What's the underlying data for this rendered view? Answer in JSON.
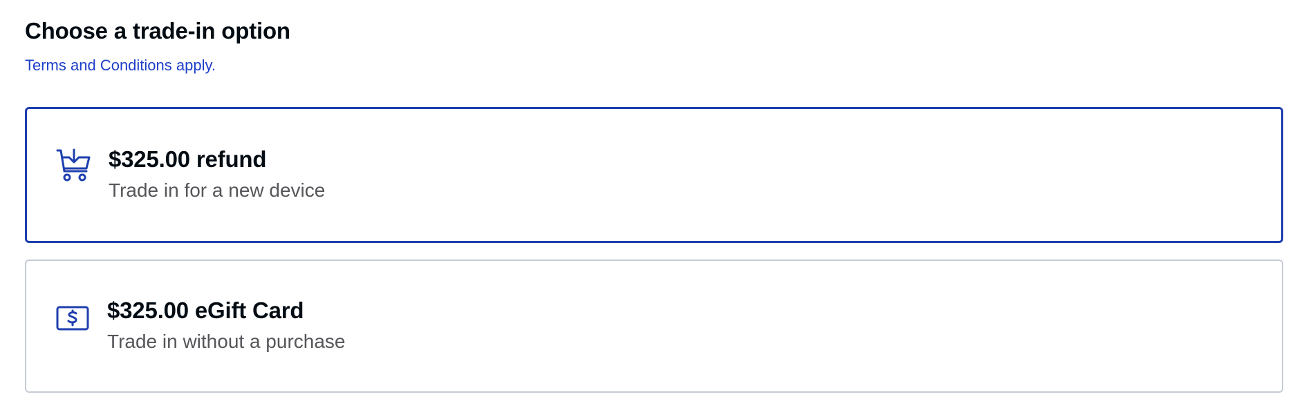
{
  "header": {
    "title": "Choose a trade-in option",
    "terms_link": "Terms and Conditions apply."
  },
  "options": [
    {
      "icon": "cart-download-icon",
      "title": "$325.00 refund",
      "subtitle": "Trade in for a new device",
      "selected": true
    },
    {
      "icon": "gift-card-dollar-icon",
      "title": "$325.00 eGift Card",
      "subtitle": "Trade in without a purchase",
      "selected": false
    }
  ],
  "colors": {
    "accent": "#1e3fae",
    "link": "#1d3ec8",
    "border_unselected": "#c5cbd5",
    "subtitle_text": "#55555a",
    "title_text": "#040c13"
  }
}
